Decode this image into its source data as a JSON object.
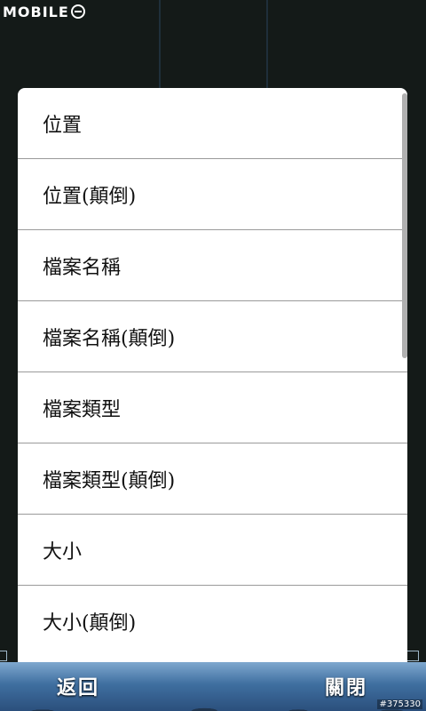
{
  "watermark": {
    "text": "MOBILE",
    "icon": "mobile01-logo-icon"
  },
  "sort_menu": {
    "items": [
      {
        "label": "位置"
      },
      {
        "label": "位置(顛倒)"
      },
      {
        "label": "檔案名稱"
      },
      {
        "label": "檔案名稱(顛倒)"
      },
      {
        "label": "檔案類型"
      },
      {
        "label": "檔案類型(顛倒)"
      },
      {
        "label": "大小"
      },
      {
        "label": "大小(顛倒)"
      }
    ]
  },
  "bottom_bar": {
    "back_label": "返回",
    "close_label": "關閉"
  },
  "post_id": "#375330",
  "colors": {
    "dialog_bg": "#ffffff",
    "divider": "#9a9a9a",
    "bar_top": "#7fa8cf",
    "bar_bottom": "#2b4f7c"
  }
}
